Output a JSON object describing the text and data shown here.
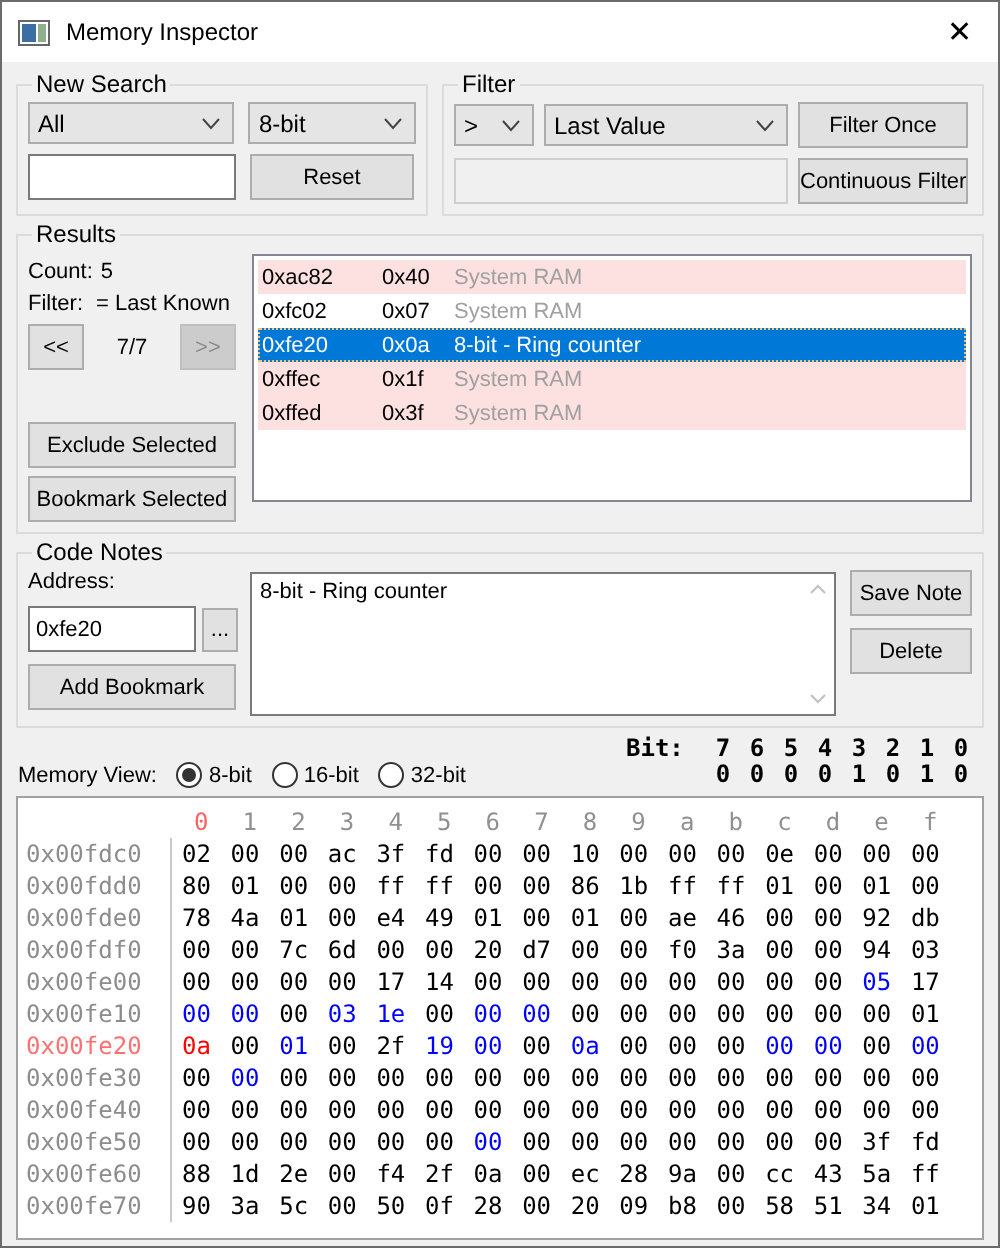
{
  "window": {
    "title": "Memory Inspector",
    "close": "✕"
  },
  "new_search": {
    "title": "New Search",
    "region": "All",
    "size": "8-bit",
    "reset": "Reset"
  },
  "filter": {
    "title": "Filter",
    "operator": ">",
    "compare": "Last Value",
    "disabled": true,
    "once": "Filter Once",
    "continuous": "Continuous Filter"
  },
  "results": {
    "title": "Results",
    "count_label": "Count:",
    "count": "5",
    "filter_label": "Filter:",
    "filter": "= Last Known",
    "prev": {
      "label": "<<",
      "disabled": false
    },
    "page": "7/7",
    "next": {
      "label": ">>",
      "disabled": true
    },
    "exclude": "Exclude Selected",
    "bookmark": "Bookmark Selected",
    "rows": [
      {
        "address": "0xac82",
        "value": "0x40",
        "description": "System RAM",
        "highlighted": true,
        "dim": true,
        "selected": false
      },
      {
        "address": "0xfc02",
        "value": "0x07",
        "description": "System RAM",
        "highlighted": false,
        "dim": true,
        "selected": false
      },
      {
        "address": "0xfe20",
        "value": "0x0a",
        "description": "8-bit - Ring counter",
        "highlighted": true,
        "dim": false,
        "selected": true
      },
      {
        "address": "0xffec",
        "value": "0x1f",
        "description": "System RAM",
        "highlighted": true,
        "dim": true,
        "selected": false
      },
      {
        "address": "0xffed",
        "value": "0x3f",
        "description": "System RAM",
        "highlighted": true,
        "dim": true,
        "selected": false
      }
    ]
  },
  "code_notes": {
    "title": "Code Notes",
    "address_label": "Address:",
    "address": "0xfe20",
    "browse": "...",
    "add_bookmark": "Add Bookmark",
    "note": "8-bit - Ring counter",
    "save": "Save Note",
    "delete": "Delete"
  },
  "memory_view": {
    "label": "Memory View:",
    "modes": [
      {
        "label": "8-bit",
        "selected": true
      },
      {
        "label": "16-bit",
        "selected": false
      },
      {
        "label": "32-bit",
        "selected": false
      }
    ],
    "bit_label": "Bit:",
    "bit_numbers": [
      "7",
      "6",
      "5",
      "4",
      "3",
      "2",
      "1",
      "0"
    ],
    "bit_values": [
      "0",
      "0",
      "0",
      "0",
      "1",
      "0",
      "1",
      "0"
    ]
  },
  "hex": {
    "columns": [
      {
        "label": "0",
        "selected": true
      },
      {
        "label": "1",
        "selected": false
      },
      {
        "label": "2",
        "selected": false
      },
      {
        "label": "3",
        "selected": false
      },
      {
        "label": "4",
        "selected": false
      },
      {
        "label": "5",
        "selected": false
      },
      {
        "label": "6",
        "selected": false
      },
      {
        "label": "7",
        "selected": false
      },
      {
        "label": "8",
        "selected": false
      },
      {
        "label": "9",
        "selected": false
      },
      {
        "label": "a",
        "selected": false
      },
      {
        "label": "b",
        "selected": false
      },
      {
        "label": "c",
        "selected": false
      },
      {
        "label": "d",
        "selected": false
      },
      {
        "label": "e",
        "selected": false
      },
      {
        "label": "f",
        "selected": false
      }
    ],
    "rows": [
      {
        "address": "0x00fdc0",
        "selected": false,
        "bytes": [
          "02",
          "00",
          "00",
          "ac",
          "3f",
          "fd",
          "00",
          "00",
          "10",
          "00",
          "00",
          "00",
          "0e",
          "00",
          "00",
          "00"
        ],
        "changed": [
          false,
          false,
          false,
          false,
          false,
          false,
          false,
          false,
          false,
          false,
          false,
          false,
          false,
          false,
          false,
          false
        ]
      },
      {
        "address": "0x00fdd0",
        "selected": false,
        "bytes": [
          "80",
          "01",
          "00",
          "00",
          "ff",
          "ff",
          "00",
          "00",
          "86",
          "1b",
          "ff",
          "ff",
          "01",
          "00",
          "01",
          "00"
        ],
        "changed": [
          false,
          false,
          false,
          false,
          false,
          false,
          false,
          false,
          false,
          false,
          false,
          false,
          false,
          false,
          false,
          false
        ]
      },
      {
        "address": "0x00fde0",
        "selected": false,
        "bytes": [
          "78",
          "4a",
          "01",
          "00",
          "e4",
          "49",
          "01",
          "00",
          "01",
          "00",
          "ae",
          "46",
          "00",
          "00",
          "92",
          "db"
        ],
        "changed": [
          false,
          false,
          false,
          false,
          false,
          false,
          false,
          false,
          false,
          false,
          false,
          false,
          false,
          false,
          false,
          false
        ]
      },
      {
        "address": "0x00fdf0",
        "selected": false,
        "bytes": [
          "00",
          "00",
          "7c",
          "6d",
          "00",
          "00",
          "20",
          "d7",
          "00",
          "00",
          "f0",
          "3a",
          "00",
          "00",
          "94",
          "03"
        ],
        "changed": [
          false,
          false,
          false,
          false,
          false,
          false,
          false,
          false,
          false,
          false,
          false,
          false,
          false,
          false,
          false,
          false
        ]
      },
      {
        "address": "0x00fe00",
        "selected": false,
        "bytes": [
          "00",
          "00",
          "00",
          "00",
          "17",
          "14",
          "00",
          "00",
          "00",
          "00",
          "00",
          "00",
          "00",
          "00",
          "05",
          "17"
        ],
        "changed": [
          false,
          false,
          false,
          false,
          false,
          false,
          false,
          false,
          false,
          false,
          false,
          false,
          false,
          false,
          true,
          false
        ]
      },
      {
        "address": "0x00fe10",
        "selected": false,
        "bytes": [
          "00",
          "00",
          "00",
          "03",
          "1e",
          "00",
          "00",
          "00",
          "00",
          "00",
          "00",
          "00",
          "00",
          "00",
          "00",
          "01"
        ],
        "changed": [
          true,
          true,
          false,
          true,
          true,
          false,
          true,
          true,
          false,
          false,
          false,
          false,
          false,
          false,
          false,
          false
        ]
      },
      {
        "address": "0x00fe20",
        "selected": true,
        "bytes": [
          "0a",
          "00",
          "01",
          "00",
          "2f",
          "19",
          "00",
          "00",
          "0a",
          "00",
          "00",
          "00",
          "00",
          "00",
          "00",
          "00"
        ],
        "changed": [
          false,
          false,
          true,
          false,
          false,
          true,
          true,
          false,
          true,
          false,
          false,
          false,
          true,
          true,
          false,
          true
        ]
      },
      {
        "address": "0x00fe30",
        "selected": false,
        "bytes": [
          "00",
          "00",
          "00",
          "00",
          "00",
          "00",
          "00",
          "00",
          "00",
          "00",
          "00",
          "00",
          "00",
          "00",
          "00",
          "00"
        ],
        "changed": [
          false,
          true,
          false,
          false,
          false,
          false,
          false,
          false,
          false,
          false,
          false,
          false,
          false,
          false,
          false,
          false
        ]
      },
      {
        "address": "0x00fe40",
        "selected": false,
        "bytes": [
          "00",
          "00",
          "00",
          "00",
          "00",
          "00",
          "00",
          "00",
          "00",
          "00",
          "00",
          "00",
          "00",
          "00",
          "00",
          "00"
        ],
        "changed": [
          false,
          false,
          false,
          false,
          false,
          false,
          false,
          false,
          false,
          false,
          false,
          false,
          false,
          false,
          false,
          false
        ]
      },
      {
        "address": "0x00fe50",
        "selected": false,
        "bytes": [
          "00",
          "00",
          "00",
          "00",
          "00",
          "00",
          "00",
          "00",
          "00",
          "00",
          "00",
          "00",
          "00",
          "00",
          "3f",
          "fd"
        ],
        "changed": [
          false,
          false,
          false,
          false,
          false,
          false,
          true,
          false,
          false,
          false,
          false,
          false,
          false,
          false,
          false,
          false
        ]
      },
      {
        "address": "0x00fe60",
        "selected": false,
        "bytes": [
          "88",
          "1d",
          "2e",
          "00",
          "f4",
          "2f",
          "0a",
          "00",
          "ec",
          "28",
          "9a",
          "00",
          "cc",
          "43",
          "5a",
          "ff"
        ],
        "changed": [
          false,
          false,
          false,
          false,
          false,
          false,
          false,
          false,
          false,
          false,
          false,
          false,
          false,
          false,
          false,
          false
        ]
      },
      {
        "address": "0x00fe70",
        "selected": false,
        "bytes": [
          "90",
          "3a",
          "5c",
          "00",
          "50",
          "0f",
          "28",
          "00",
          "20",
          "09",
          "b8",
          "00",
          "58",
          "51",
          "34",
          "01"
        ],
        "changed": [
          false,
          false,
          false,
          false,
          false,
          false,
          false,
          false,
          false,
          false,
          false,
          false,
          false,
          false,
          false,
          false
        ]
      }
    ]
  }
}
